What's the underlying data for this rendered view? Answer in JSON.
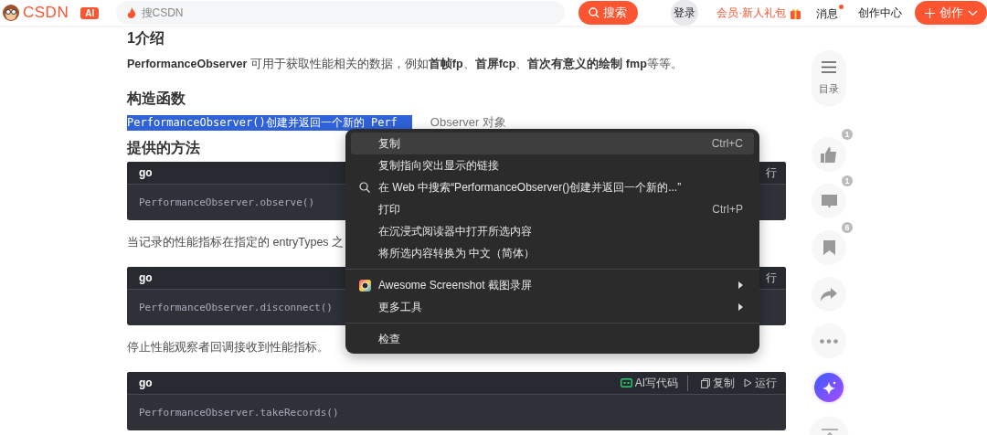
{
  "header": {
    "logo": "CSDN",
    "ai_badge": "AI",
    "search": {
      "placeholder": "搜CSDN"
    },
    "search_button": "搜索",
    "login": "登录",
    "vip": "会员·新人礼包",
    "messages": {
      "label": "消息",
      "dot": true
    },
    "creator_center": "创作中心",
    "create_button": "创作"
  },
  "article": [
    {
      "kind": "heading",
      "text": "1介绍"
    },
    {
      "kind": "paragraph",
      "text": "**PerformanceObserver** 可用于获取性能相关的数据，例如**首帧fp**、**首屏fcp**、**首次有意义的绘制 fmp**等等。"
    },
    {
      "kind": "heading",
      "text": "构造函数"
    },
    {
      "kind": "selection",
      "selected_text": "PerformanceObserver()创建并返回一个新的 Perf",
      "rest": "Observer 对象"
    },
    {
      "kind": "heading",
      "text": "提供的方法"
    },
    {
      "kind": "code",
      "lang": "go",
      "code": "PerformanceObserver.observe()",
      "actions": [
        {
          "kind": "text",
          "label": "行"
        }
      ]
    },
    {
      "kind": "paragraph",
      "text": "当记录的性能指标在指定的 entryTypes 之"
    },
    {
      "kind": "code",
      "lang": "go",
      "code": "PerformanceObserver.disconnect()",
      "actions": [
        {
          "kind": "text",
          "label": "行"
        }
      ]
    },
    {
      "kind": "paragraph",
      "text": "停止性能观察者回调接收到性能指标。"
    },
    {
      "kind": "code",
      "lang": "go",
      "code": "PerformanceObserver.takeRecords()",
      "actions": [
        {
          "kind": "ai",
          "label": "AI写代码"
        },
        {
          "kind": "copy",
          "label": "复制"
        },
        {
          "kind": "run",
          "label": "运行"
        }
      ]
    }
  ],
  "rail": [
    {
      "kind": "toc",
      "label": "目录"
    },
    {
      "kind": "like",
      "badge": "1"
    },
    {
      "kind": "comment",
      "badge": "1"
    },
    {
      "kind": "collect",
      "badge": "6"
    },
    {
      "kind": "share"
    },
    {
      "kind": "more"
    },
    {
      "kind": "ai"
    },
    {
      "kind": "top"
    }
  ],
  "context_menu": {
    "groups": [
      {
        "items": [
          {
            "kind": "plain",
            "label": "复制",
            "shortcut": "Ctrl+C",
            "selected": true
          },
          {
            "kind": "plain",
            "label": "复制指向突出显示的链接",
            "selected": false
          },
          {
            "kind": "search",
            "label": "在 Web 中搜索“PerformanceObserver()创建并返回一个新的...”",
            "selected": false
          },
          {
            "kind": "plain",
            "label": "打印",
            "shortcut": "Ctrl+P",
            "selected": false
          },
          {
            "kind": "plain",
            "label": "在沉浸式阅读器中打开所选内容",
            "selected": false
          },
          {
            "kind": "plain",
            "label": "将所选内容转换为 中文（简体）",
            "selected": false
          }
        ]
      },
      {
        "items": [
          {
            "kind": "extension",
            "label": "Awesome Screenshot 截图录屏",
            "submenu": true,
            "selected": false
          },
          {
            "kind": "plain",
            "label": "更多工具",
            "submenu": true,
            "selected": false
          }
        ]
      },
      {
        "items": [
          {
            "kind": "plain",
            "label": "检查",
            "selected": false
          }
        ]
      }
    ]
  }
}
